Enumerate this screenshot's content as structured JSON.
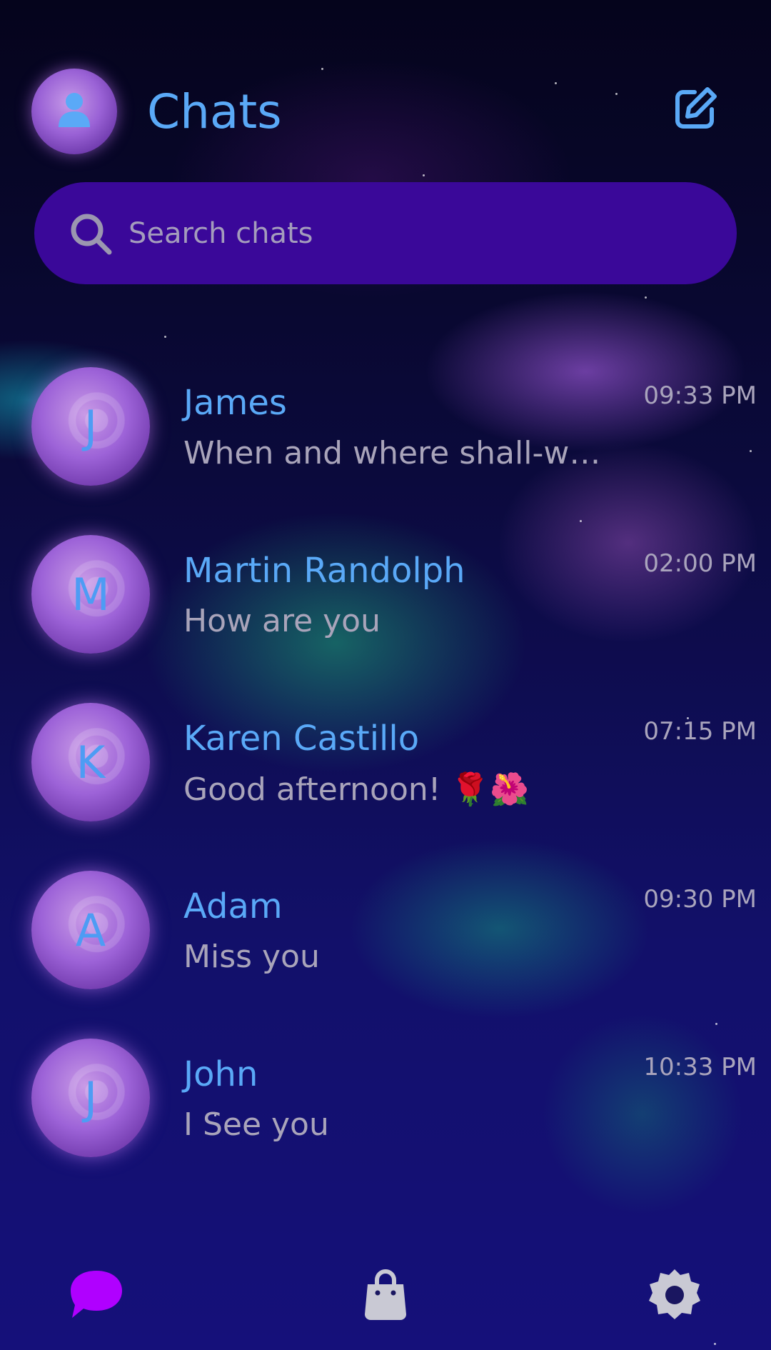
{
  "header": {
    "title": "Chats"
  },
  "search": {
    "placeholder": "Search chats"
  },
  "chats": [
    {
      "initial": "J",
      "name": "James",
      "time": "09:33 PM",
      "preview": "When and where shall-we..."
    },
    {
      "initial": "M",
      "name": "Martin Randolph",
      "time": "02:00 PM",
      "preview": "How are you"
    },
    {
      "initial": "K",
      "name": "Karen Castillo",
      "time": "07:15 PM",
      "preview": "Good afternoon! 🌹🌺"
    },
    {
      "initial": "A",
      "name": "Adam",
      "time": "09:30 PM",
      "preview": "Miss you"
    },
    {
      "initial": "J",
      "name": "John",
      "time": "10:33 PM",
      "preview": "I See you"
    }
  ],
  "nav": {
    "items": [
      {
        "icon": "chat-bubble-icon",
        "active": true
      },
      {
        "icon": "shopping-bag-icon",
        "active": false
      },
      {
        "icon": "settings-gear-icon",
        "active": false
      }
    ]
  },
  "colors": {
    "accent": "#5aa9f7",
    "search_bg": "#3a0899",
    "nav_active": "#b000ff",
    "nav_inactive": "#c9c9d4",
    "muted_text": "#a9a4bc"
  }
}
